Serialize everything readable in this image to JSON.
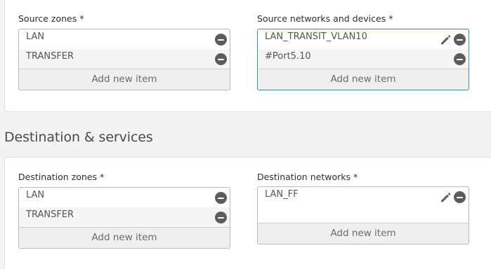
{
  "source": {
    "zones": {
      "label": "Source zones *",
      "items": [
        "LAN",
        "TRANSFER"
      ],
      "add_label": "Add new item"
    },
    "networks": {
      "label": "Source networks and devices *",
      "items": [
        "LAN_TRANSIT_VLAN10",
        "#Port5.10"
      ],
      "add_label": "Add new item"
    }
  },
  "destination": {
    "title": "Destination & services",
    "zones": {
      "label": "Destination zones *",
      "items": [
        "LAN",
        "TRANSFER"
      ],
      "add_label": "Add new item"
    },
    "networks": {
      "label": "Destination networks *",
      "items": [
        "LAN_FF"
      ],
      "add_label": "Add new item"
    }
  },
  "icons": {
    "remove": "minus-circle-icon",
    "edit": "pencil-icon"
  },
  "colors": {
    "focus_border": "#3f8bb8",
    "icon": "#5c5c5c"
  }
}
